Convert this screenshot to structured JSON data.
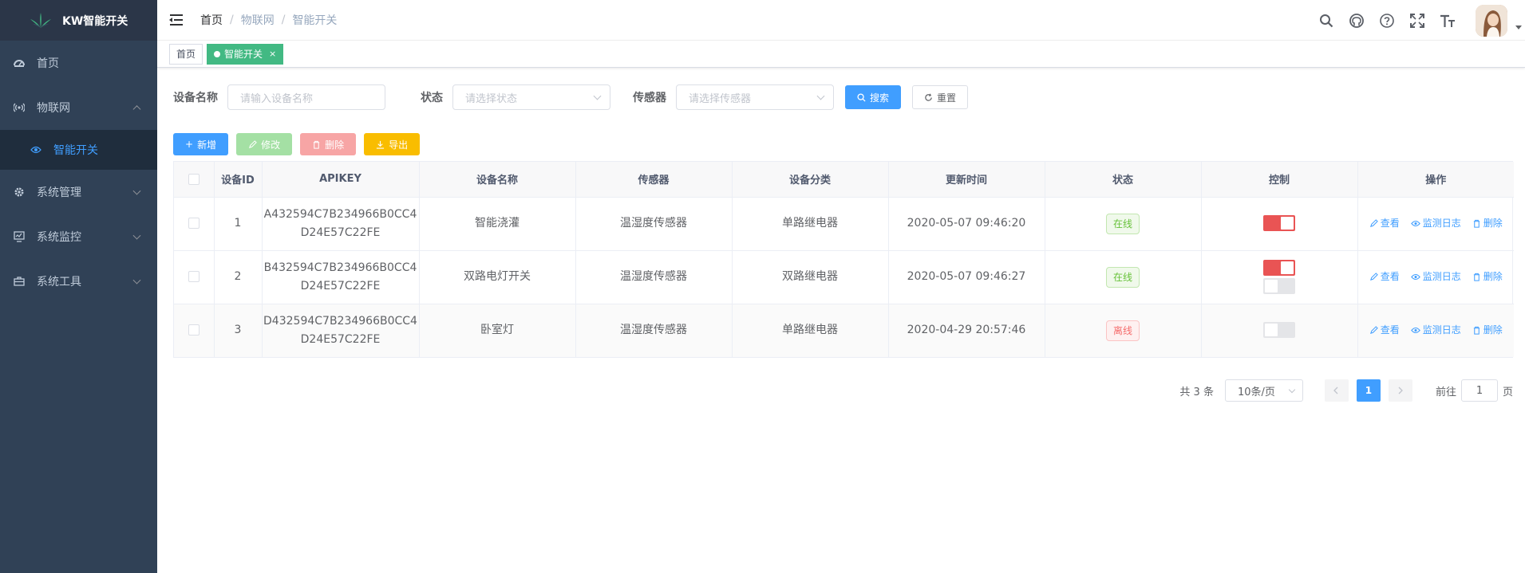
{
  "app": {
    "title": "KW智能开关"
  },
  "sidebar": {
    "items": [
      {
        "label": "首页",
        "icon": "dashboard-icon",
        "expanded": null
      },
      {
        "label": "物联网",
        "icon": "broadcast-icon",
        "expanded": true
      },
      {
        "label": "智能开关",
        "icon": "eye-icon",
        "active": true,
        "child": true
      },
      {
        "label": "系统管理",
        "icon": "gear-icon",
        "expanded": false
      },
      {
        "label": "系统监控",
        "icon": "monitor-icon",
        "expanded": false
      },
      {
        "label": "系统工具",
        "icon": "toolbox-icon",
        "expanded": false
      }
    ]
  },
  "breadcrumb": [
    "首页",
    "物联网",
    "智能开关"
  ],
  "nav_icons": [
    "search-icon",
    "github-icon",
    "question-icon",
    "fullscreen-icon",
    "font-size-icon"
  ],
  "tags": [
    {
      "label": "首页",
      "active": false
    },
    {
      "label": "智能开关",
      "active": true,
      "close": "×"
    }
  ],
  "search": {
    "device_name_label": "设备名称",
    "device_name_placeholder": "请输入设备名称",
    "status_label": "状态",
    "status_placeholder": "请选择状态",
    "sensor_label": "传感器",
    "sensor_placeholder": "请选择传感器",
    "search_button": "搜索",
    "reset_button": "重置"
  },
  "toolbar": {
    "add": "新增",
    "edit": "修改",
    "delete": "删除",
    "export": "导出"
  },
  "table": {
    "columns": [
      "设备ID",
      "APIKEY",
      "设备名称",
      "传感器",
      "设备分类",
      "更新时间",
      "状态",
      "控制",
      "操作"
    ],
    "rows": [
      {
        "id": "1",
        "apikey_1": "A432594C7B234966B0CC4",
        "apikey_2": "D24E57C22FE",
        "name": "智能浇灌",
        "sensor": "温湿度传感器",
        "category": "单路继电器",
        "updated": "2020-05-07 09:46:20",
        "status": "在线",
        "online": true,
        "switches": [
          true
        ]
      },
      {
        "id": "2",
        "apikey_1": "B432594C7B234966B0CC4",
        "apikey_2": "D24E57C22FE",
        "name": "双路电灯开关",
        "sensor": "温湿度传感器",
        "category": "双路继电器",
        "updated": "2020-05-07 09:46:27",
        "status": "在线",
        "online": true,
        "switches": [
          true,
          false
        ]
      },
      {
        "id": "3",
        "apikey_1": "D432594C7B234966B0CC4",
        "apikey_2": "D24E57C22FE",
        "name": "卧室灯",
        "sensor": "温湿度传感器",
        "category": "单路继电器",
        "updated": "2020-04-29 20:57:46",
        "status": "离线",
        "online": false,
        "switches": [
          false
        ]
      }
    ],
    "ops": {
      "view": "查看",
      "log": "监测日志",
      "delete": "删除"
    }
  },
  "pagination": {
    "total": "共 3 条",
    "page_size": "10条/页",
    "current": "1",
    "goto_prefix": "前往",
    "goto_value": "1",
    "goto_suffix": "页"
  },
  "colors": {
    "sidebar_bg": "#304156",
    "accent": "#409eff",
    "tag_active": "#42b983",
    "switch_on": "#e95454",
    "online": "#67c23a",
    "offline": "#f56c6c"
  }
}
